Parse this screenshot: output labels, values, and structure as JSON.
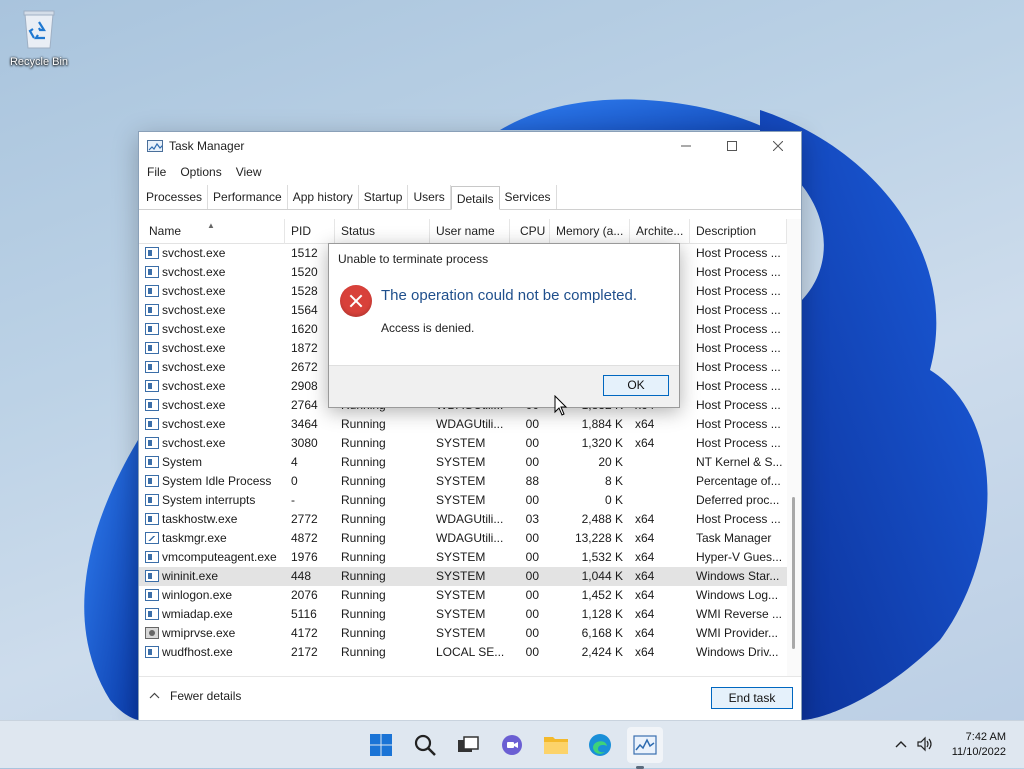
{
  "desktop": {
    "recycle_bin_label": "Recycle Bin"
  },
  "window": {
    "title": "Task Manager",
    "menu": [
      "File",
      "Options",
      "View"
    ],
    "tabs": [
      "Processes",
      "Performance",
      "App history",
      "Startup",
      "Users",
      "Details",
      "Services"
    ],
    "active_tab": "Details"
  },
  "table": {
    "columns": [
      "Name",
      "PID",
      "Status",
      "User name",
      "CPU",
      "Memory (a...",
      "Archite...",
      "Description"
    ],
    "rows": [
      {
        "name": "svchost.exe",
        "pid": "1512",
        "status": "",
        "user": "",
        "cpu": "",
        "mem": "",
        "arch": "",
        "desc": "Host Process ..."
      },
      {
        "name": "svchost.exe",
        "pid": "1520",
        "status": "",
        "user": "",
        "cpu": "",
        "mem": "",
        "arch": "",
        "desc": "Host Process ..."
      },
      {
        "name": "svchost.exe",
        "pid": "1528",
        "status": "",
        "user": "",
        "cpu": "",
        "mem": "",
        "arch": "",
        "desc": "Host Process ..."
      },
      {
        "name": "svchost.exe",
        "pid": "1564",
        "status": "",
        "user": "",
        "cpu": "",
        "mem": "",
        "arch": "",
        "desc": "Host Process ..."
      },
      {
        "name": "svchost.exe",
        "pid": "1620",
        "status": "",
        "user": "",
        "cpu": "",
        "mem": "",
        "arch": "",
        "desc": "Host Process ..."
      },
      {
        "name": "svchost.exe",
        "pid": "1872",
        "status": "",
        "user": "",
        "cpu": "",
        "mem": "",
        "arch": "",
        "desc": "Host Process ..."
      },
      {
        "name": "svchost.exe",
        "pid": "2672",
        "status": "",
        "user": "",
        "cpu": "",
        "mem": "",
        "arch": "",
        "desc": "Host Process ..."
      },
      {
        "name": "svchost.exe",
        "pid": "2908",
        "status": "",
        "user": "",
        "cpu": "",
        "mem": "",
        "arch": "",
        "desc": "Host Process ..."
      },
      {
        "name": "svchost.exe",
        "pid": "2764",
        "status": "Running",
        "user": "WDAGUtili...",
        "cpu": "00",
        "mem": "1,832 K",
        "arch": "x64",
        "desc": "Host Process ..."
      },
      {
        "name": "svchost.exe",
        "pid": "3464",
        "status": "Running",
        "user": "WDAGUtili...",
        "cpu": "00",
        "mem": "1,884 K",
        "arch": "x64",
        "desc": "Host Process ..."
      },
      {
        "name": "svchost.exe",
        "pid": "3080",
        "status": "Running",
        "user": "SYSTEM",
        "cpu": "00",
        "mem": "1,320 K",
        "arch": "x64",
        "desc": "Host Process ..."
      },
      {
        "name": "System",
        "pid": "4",
        "status": "Running",
        "user": "SYSTEM",
        "cpu": "00",
        "mem": "20 K",
        "arch": "",
        "desc": "NT Kernel & S..."
      },
      {
        "name": "System Idle Process",
        "pid": "0",
        "status": "Running",
        "user": "SYSTEM",
        "cpu": "88",
        "mem": "8 K",
        "arch": "",
        "desc": "Percentage of..."
      },
      {
        "name": "System interrupts",
        "pid": "-",
        "status": "Running",
        "user": "SYSTEM",
        "cpu": "00",
        "mem": "0 K",
        "arch": "",
        "desc": "Deferred proc..."
      },
      {
        "name": "taskhostw.exe",
        "pid": "2772",
        "status": "Running",
        "user": "WDAGUtili...",
        "cpu": "03",
        "mem": "2,488 K",
        "arch": "x64",
        "desc": "Host Process ..."
      },
      {
        "name": "taskmgr.exe",
        "pid": "4872",
        "status": "Running",
        "user": "WDAGUtili...",
        "cpu": "00",
        "mem": "13,228 K",
        "arch": "x64",
        "desc": "Task Manager"
      },
      {
        "name": "vmcomputeagent.exe",
        "pid": "1976",
        "status": "Running",
        "user": "SYSTEM",
        "cpu": "00",
        "mem": "1,532 K",
        "arch": "x64",
        "desc": "Hyper-V Gues..."
      },
      {
        "name": "wininit.exe",
        "pid": "448",
        "status": "Running",
        "user": "SYSTEM",
        "cpu": "00",
        "mem": "1,044 K",
        "arch": "x64",
        "desc": "Windows Star..."
      },
      {
        "name": "winlogon.exe",
        "pid": "2076",
        "status": "Running",
        "user": "SYSTEM",
        "cpu": "00",
        "mem": "1,452 K",
        "arch": "x64",
        "desc": "Windows Log..."
      },
      {
        "name": "wmiadap.exe",
        "pid": "5116",
        "status": "Running",
        "user": "SYSTEM",
        "cpu": "00",
        "mem": "1,128 K",
        "arch": "x64",
        "desc": "WMI Reverse ..."
      },
      {
        "name": "wmiprvse.exe",
        "pid": "4172",
        "status": "Running",
        "user": "SYSTEM",
        "cpu": "00",
        "mem": "6,168 K",
        "arch": "x64",
        "desc": "WMI Provider..."
      },
      {
        "name": "wudfhost.exe",
        "pid": "2172",
        "status": "Running",
        "user": "LOCAL SE...",
        "cpu": "00",
        "mem": "2,424 K",
        "arch": "x64",
        "desc": "Windows Driv..."
      }
    ],
    "selected_index": 17
  },
  "footer": {
    "fewer_details_label": "Fewer details",
    "end_task_label": "End task"
  },
  "dialog": {
    "title": "Unable to terminate process",
    "main_instruction": "The operation could not be completed.",
    "content": "Access is denied.",
    "ok_label": "OK"
  },
  "taskbar": {
    "time": "7:42 AM",
    "date": "11/10/2022",
    "apps": [
      "start-icon",
      "search-icon",
      "task-view-icon",
      "chat-icon",
      "file-explorer-icon",
      "edge-icon",
      "task-manager-icon"
    ]
  }
}
